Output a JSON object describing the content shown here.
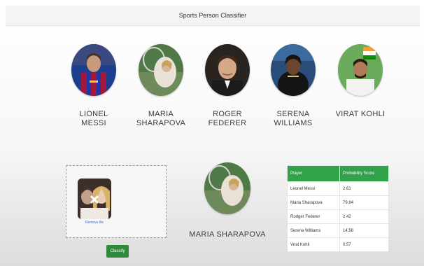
{
  "navbar": {
    "title": "Sports Person Classifier"
  },
  "players": [
    {
      "id": "messi",
      "name": "LIONEL MESSI",
      "line1": "LIONEL",
      "line2": "MESSI"
    },
    {
      "id": "sharapova",
      "name": "MARIA SHARAPOVA",
      "line1": "MARIA",
      "line2": "SHARAPOVA"
    },
    {
      "id": "federer",
      "name": "ROGER FEDERER",
      "line1": "ROGER",
      "line2": "FEDERER"
    },
    {
      "id": "williams",
      "name": "SERENA WILLIAMS",
      "line1": "SERENA",
      "line2": "WILLIAMS"
    },
    {
      "id": "kohli",
      "name": "VIRAT KOHLI",
      "line1": "VIRAT KOHLI",
      "line2": ""
    }
  ],
  "upload": {
    "remove_label": "Remove file"
  },
  "classify_button": {
    "label": "Classify"
  },
  "result": {
    "name": "MARIA SHARAPOVA"
  },
  "table": {
    "headers": [
      "Player",
      "Probability Score"
    ],
    "rows": [
      {
        "player": "Leonel Messi",
        "score": "2.61"
      },
      {
        "player": "Maria Sharapova",
        "score": "79.84"
      },
      {
        "player": "Rodger Federer",
        "score": "2.42"
      },
      {
        "player": "Serena Williams",
        "score": "14.56"
      },
      {
        "player": "Virat Kohli",
        "score": "0.57"
      }
    ]
  },
  "colors": {
    "accent": "#2fa24a",
    "button": "#2d8a3c",
    "link": "#4a6fb5"
  }
}
